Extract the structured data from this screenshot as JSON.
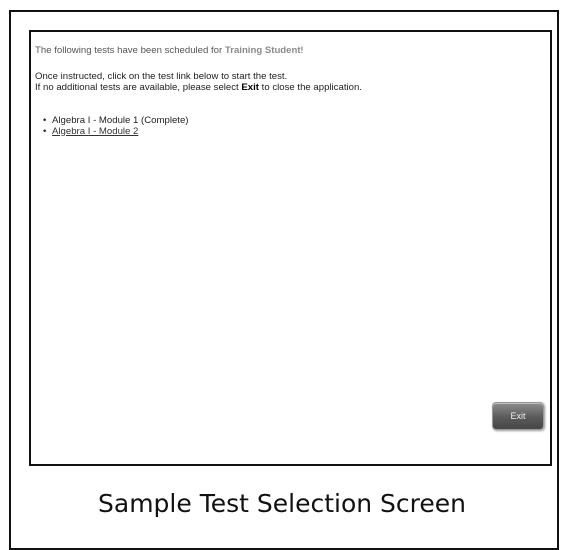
{
  "screen": {
    "intro_prefix": "The following tests have been scheduled for ",
    "student_name": "Training Student",
    "intro_suffix": "!",
    "instruction_line1": "Once instructed, click on the test link below to start the test.",
    "instruction_line2_prefix": "If no additional tests are available, please select ",
    "instruction_line2_bold": "Exit",
    "instruction_line2_suffix": " to close the application.",
    "tests": [
      {
        "label": "Algebra I - Module 1 (Complete)",
        "is_link": false
      },
      {
        "label": "Algebra I - Module 2",
        "is_link": true
      }
    ],
    "exit_label": "Exit"
  },
  "caption": "Sample Test Selection Screen"
}
